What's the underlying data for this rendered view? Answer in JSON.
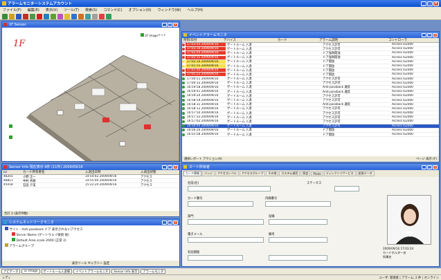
{
  "app": {
    "title": "アラームモニタ－システムアカウント",
    "menu": [
      "ファイル(F)",
      "編集(E)",
      "表示(V)",
      "ツール(T)",
      "検索(S)",
      "コマンド(C)",
      "オプション(O)",
      "ウィンドウ(W)",
      "ヘルプ(H)"
    ]
  },
  "map_panel": {
    "title": "1F Sensor",
    "floor_label": "1F",
    "markers": [
      "2F Image",
      "テント"
    ]
  },
  "alarm_monitor": {
    "title": "イベントアラームモニタ",
    "columns": [
      "時刻/日付",
      "デバイス",
      "カード",
      "アラーム説明",
      "コントローラ"
    ],
    "rows": [
      {
        "time": "17:03:44 2009/09/16",
        "device": "ゲートルーム 入退",
        "card": "",
        "desc": "アクセス許可",
        "ctrl": "Access Io2000",
        "flag": "red"
      },
      {
        "time": "17:03:18 2009/09/16",
        "device": "ゲートルーム 入退",
        "card": "",
        "desc": "アクセス許可",
        "ctrl": "Access Io2000",
        "flag": "red"
      },
      {
        "time": "17:02:44 2009/09/16",
        "device": "ゲートルーム 入退",
        "card": "",
        "desc": "ドア強制開放",
        "ctrl": "Access Io2000",
        "flag": "red"
      },
      {
        "time": "17:02:31 2009/09/16",
        "device": "ゲートルーム 入退",
        "card": "",
        "desc": "ドア強制開放",
        "ctrl": "Access Io2000",
        "flag": "red"
      },
      {
        "time": "17:02:10 2009/09/16",
        "device": "ゲートルーム 入退",
        "card": "",
        "desc": "ドア開放",
        "ctrl": "Access Io2000",
        "flag": "yel"
      },
      {
        "time": "17:01:55 2009/09/16",
        "device": "ゲートルーム 入退",
        "card": "",
        "desc": "ドア開放",
        "ctrl": "Access Io2000",
        "flag": "yel"
      },
      {
        "time": "17:01:40 2009/09/16",
        "device": "ゲートルーム 入退",
        "card": "",
        "desc": "ドア開放",
        "ctrl": "Access Io2000",
        "flag": "red"
      },
      {
        "time": "17:01:22 2009/09/16",
        "device": "ゲートルーム 入退",
        "card": "",
        "desc": "ドア開放",
        "ctrl": "Access Io2000",
        "flag": "red"
      },
      {
        "time": "17:00:51 2009/09/16",
        "device": "ゲートルーム 入退",
        "card": "",
        "desc": "アクセス許可",
        "ctrl": "Access Io2000",
        "flag": ""
      },
      {
        "time": "17:00:33 2009/09/16",
        "device": "ゲートルーム 入退",
        "card": "",
        "desc": "アクセス許可",
        "ctrl": "Access Io2000",
        "flag": ""
      },
      {
        "time": "16:59:58 2009/09/16",
        "device": "ゲートルーム 入退",
        "card": "",
        "desc": "Anti-passback 違反",
        "ctrl": "Access Io2000",
        "flag": ""
      },
      {
        "time": "16:59:41 2009/09/16",
        "device": "ゲートルーム 入退",
        "card": "",
        "desc": "Anti-passback 違反",
        "ctrl": "Access Io2000",
        "flag": ""
      },
      {
        "time": "16:59:20 2009/09/16",
        "device": "ゲートルーム 入退",
        "card": "",
        "desc": "アクセス許可",
        "ctrl": "Access Io2000",
        "flag": ""
      },
      {
        "time": "16:58:59 2009/09/16",
        "device": "ゲートルーム 入退",
        "card": "",
        "desc": "アクセス許可",
        "ctrl": "Access Io2000",
        "flag": ""
      },
      {
        "time": "16:58:31 2009/09/16",
        "device": "ゲートルーム 入退",
        "card": "",
        "desc": "Anti-passback 違反",
        "ctrl": "Access Io2000",
        "flag": ""
      },
      {
        "time": "16:58:12 2009/09/16",
        "device": "ゲートルーム 入退",
        "card": "",
        "desc": "アクセス許可",
        "ctrl": "Access Io2000",
        "flag": ""
      },
      {
        "time": "16:57:50 2009/09/16",
        "device": "ゲートルーム 入退",
        "card": "",
        "desc": "アクセス許可",
        "ctrl": "Access Io2000",
        "flag": ""
      },
      {
        "time": "16:57:33 2009/09/16",
        "device": "ゲートルーム 入退",
        "card": "",
        "desc": "アクセス許可",
        "ctrl": "Access Io2000",
        "flag": ""
      },
      {
        "time": "16:57:02 2009/09/16",
        "device": "ゲートルーム 入退",
        "card": "",
        "desc": "アクセス許可",
        "ctrl": "Access Io2000",
        "flag": ""
      },
      {
        "time": "16:56:44 2009/09/16",
        "device": "ゲートルーム 入退",
        "card": "",
        "desc": "アクセス許可",
        "ctrl": "Access Io2000",
        "flag": "sel"
      },
      {
        "time": "16:56:20 2009/09/16",
        "device": "ゲートルーム 入退",
        "card": "",
        "desc": "ドア開放",
        "ctrl": "Access Io2000",
        "flag": ""
      },
      {
        "time": "16:55:58 2009/09/16",
        "device": "ゲートルーム 入退",
        "card": "",
        "desc": "ドア開放",
        "ctrl": "Access Io2000",
        "flag": ""
      }
    ],
    "footer_left": "選択レポート アクション(A)",
    "footer_right": "ページ 表示 (F)"
  },
  "event_list": {
    "title": "Sensor Info 現在表示 9件 (11件) 2009/09/16",
    "columns": [
      "ID",
      "カード所有者名",
      "入退出日時",
      "入退出状態"
    ],
    "rows": [
      {
        "id": "48201",
        "name": "小野 正一",
        "time": "14:54:42 2009/09/16",
        "state": "アクセス"
      },
      {
        "id": "48811",
        "name": "中村 秀樹",
        "time": "14:55:40 2009/09/16",
        "state": "アクセス"
      },
      {
        "id": "45018",
        "name": "石田 夕美",
        "time": "15:22:24 2009/09/16",
        "state": "アクセス"
      }
    ],
    "footer": "合計 2 (表示件数)"
  },
  "tree_panel": {
    "title": "システムネットワークモニタ",
    "items": [
      "サイト - Anti-passback ドア 表示されないアクセス",
      "Server Name (ゲートウェイ接続 他)",
      "Default Area scale 2000 (正常 2)",
      "アラームグループ"
    ],
    "footer": "表示ツール ギャラリー 設定"
  },
  "card_panel": {
    "title": "カード所有者",
    "tabs": [
      "カード情報",
      "バッジ",
      "アクセスレベル",
      "アクセスグループ",
      "その他",
      "カスタム項目",
      "照会",
      "Photo",
      "ディレクトリサービス",
      "拡張データ"
    ],
    "labels": {
      "name": "名前(名)",
      "card_no": "カード番号",
      "status": "ステータス",
      "extension": "内線番号",
      "dept": "部門",
      "title": "役職",
      "email": "電子メール",
      "notes": "備考",
      "expire": "有効期限"
    },
    "photo_caption": "2009/09/16 17:03:24",
    "photo_sub": "カードホルダー名",
    "photo_sub2": "所属名"
  },
  "taskbar": [
    "ナビゲータ",
    "1F Image",
    "ゲートルーム入退場",
    "イベントアラームモニタ",
    "Sensor Info 表示",
    "アラームモニタ"
  ],
  "statusbar": {
    "left": "レディ",
    "right": "ユーザ: 管理者 | アラーム: 2 件 | オンライン"
  },
  "colors": {
    "title_blue": "#0b4fd3",
    "alarm_red": "#e63a2a",
    "alarm_yellow": "#f5e04a",
    "select_blue": "#2b59c3"
  }
}
